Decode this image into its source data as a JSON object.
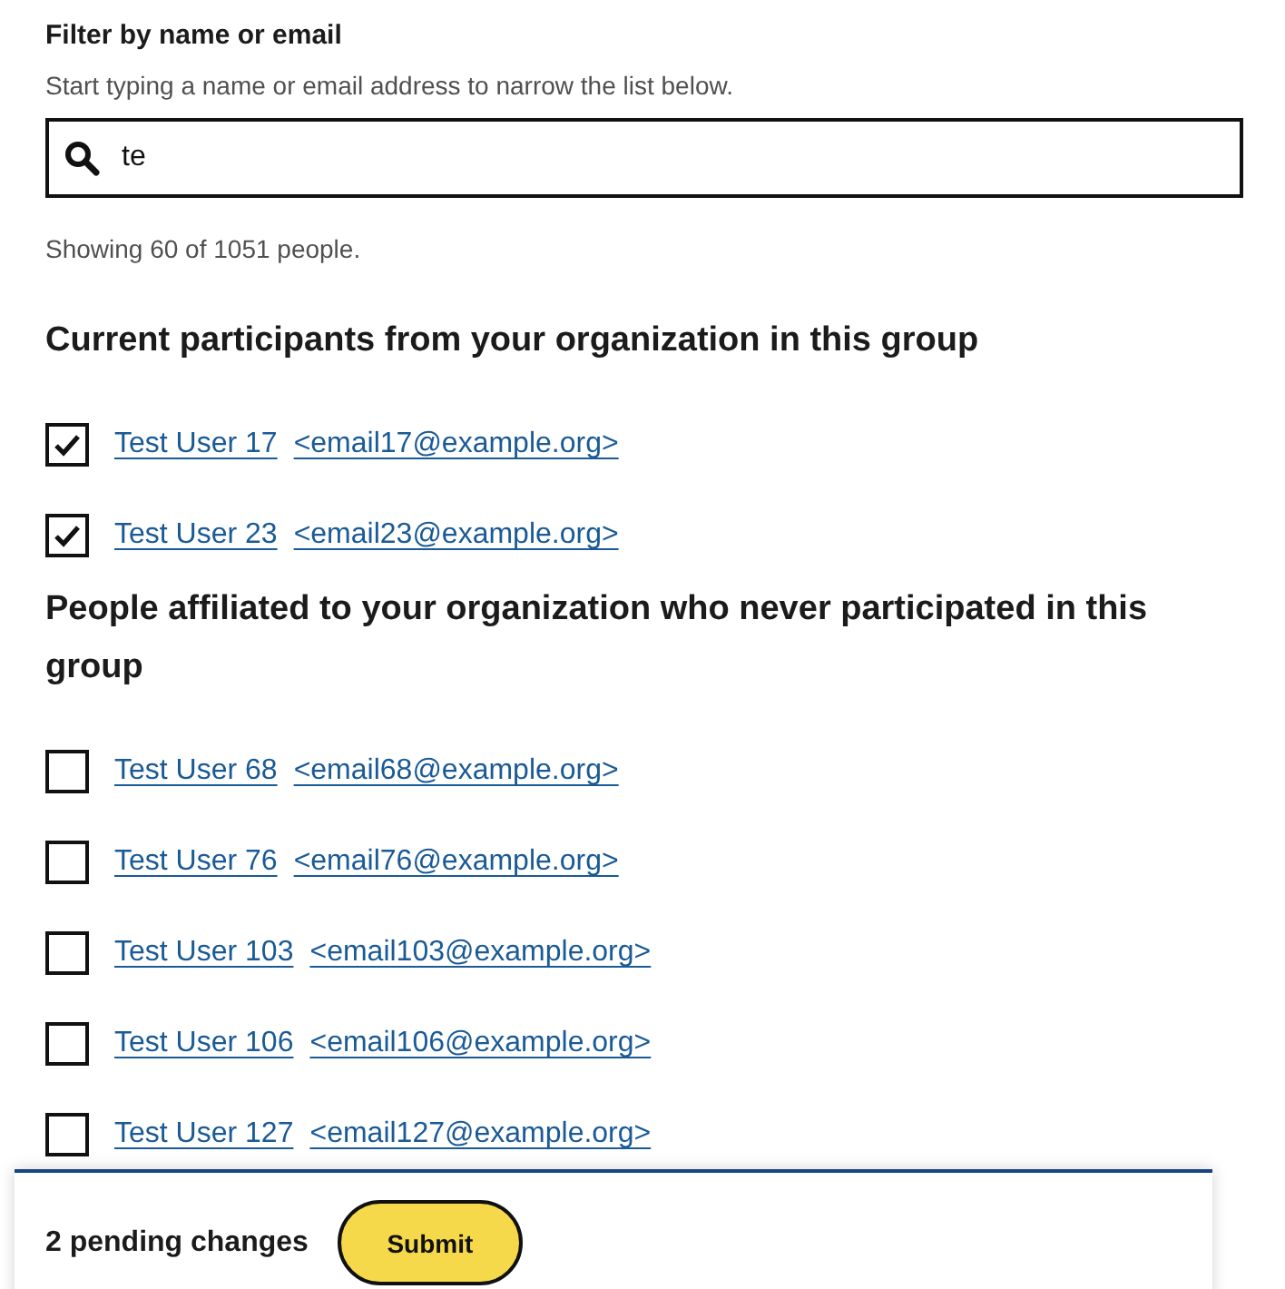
{
  "filter": {
    "label": "Filter by name or email",
    "hint": "Start typing a name or email address to narrow the list below.",
    "value": "te"
  },
  "count": "Showing 60 of 1051 people.",
  "groups": [
    {
      "heading": "Current participants from your organization in this group",
      "people": [
        {
          "name": "Test User 17",
          "email": "<email17@example.org>",
          "checked": true
        },
        {
          "name": "Test User 23",
          "email": "<email23@example.org>",
          "checked": true
        }
      ]
    },
    {
      "heading": "People affiliated to your organization who never participated in this group",
      "people": [
        {
          "name": "Test User 68",
          "email": "<email68@example.org>",
          "checked": false
        },
        {
          "name": "Test User 76",
          "email": "<email76@example.org>",
          "checked": false
        },
        {
          "name": "Test User 103",
          "email": "<email103@example.org>",
          "checked": false
        },
        {
          "name": "Test User 106",
          "email": "<email106@example.org>",
          "checked": false
        },
        {
          "name": "Test User 127",
          "email": "<email127@example.org>",
          "checked": false
        }
      ]
    }
  ],
  "footer": {
    "pending": "2 pending changes",
    "submit": "Submit"
  }
}
